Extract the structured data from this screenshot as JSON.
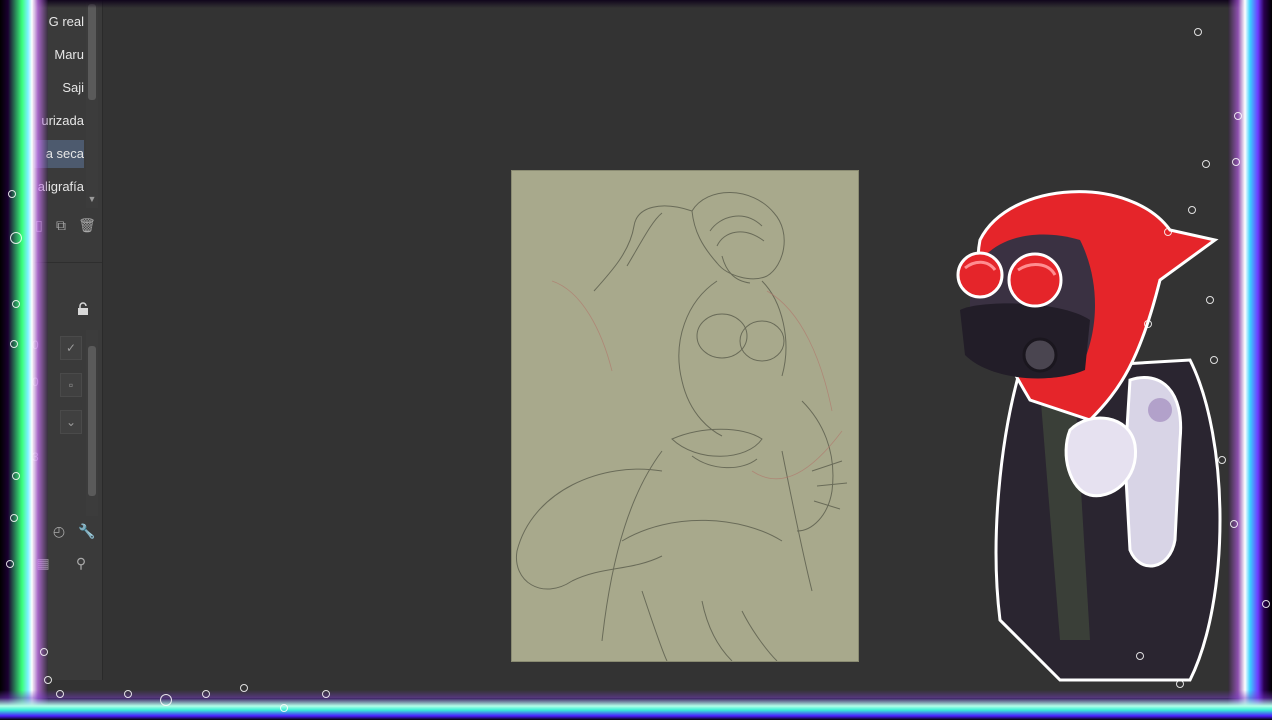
{
  "brush_list": {
    "items": [
      {
        "label": "G real",
        "selected": false
      },
      {
        "label": "Maru",
        "selected": false
      },
      {
        "label": "Saji",
        "selected": false
      },
      {
        "label": "urizada",
        "selected": false
      },
      {
        "label": "a seca",
        "selected": true
      },
      {
        "label": "aligrafía",
        "selected": false
      }
    ]
  },
  "brush_toolbar": {
    "new_icon": "new-page-icon",
    "duplicate_icon": "duplicate-icon",
    "delete_icon": "trash-icon"
  },
  "tool_property": {
    "lock_icon": "lock-icon",
    "rows": [
      {
        "value": "0",
        "icon": "check-icon"
      },
      {
        "value": "0",
        "icon": "square-icon"
      },
      {
        "value": "",
        "icon": "chevron-down-icon"
      },
      {
        "value": "3",
        "icon": ""
      }
    ],
    "footer_icons": [
      "dial-icon",
      "wrench-icon"
    ]
  },
  "colors": {
    "workspace": "#333333",
    "panel": "#3a3a3a",
    "canvas_paper": "#a8a98c",
    "sketch_line": "#5f6150",
    "sketch_red": "#b27268",
    "overlay_hood": "#e5252a",
    "overlay_vest": "#2a2530"
  }
}
